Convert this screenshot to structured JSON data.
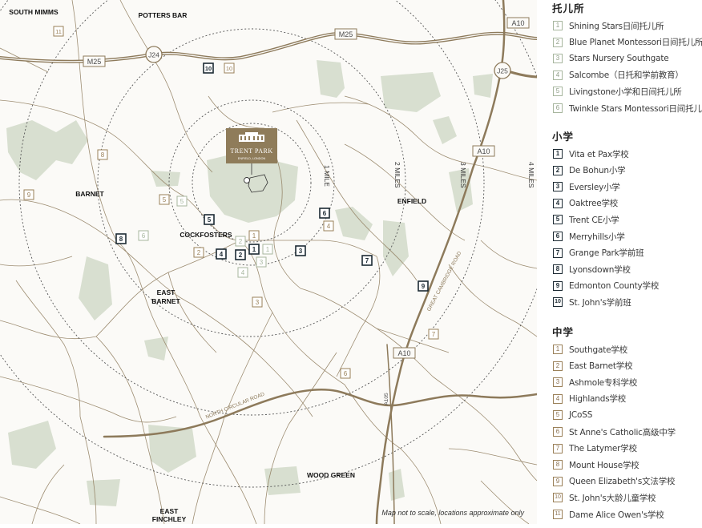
{
  "map": {
    "places": {
      "south_mimms": "SOUTH MIMMS",
      "potters_bar": "POTTERS BAR",
      "barnet": "BARNET",
      "cockfosters": "COCKFOSTERS",
      "east_barnet": "EAST\nBARNET",
      "enfield": "ENFIELD",
      "wood_green": "WOOD GREEN",
      "east_finchley": "EAST\nFINCHLEY"
    },
    "roads": {
      "m25_west": "M25",
      "m25_east": "M25",
      "j24": "J24",
      "j25": "J25",
      "a10_top": "A10",
      "a10_mid": "A10",
      "a10_low": "A10",
      "a1055": "A105",
      "great_cambridge_road": "GREAT CAMBRIDGE ROAD",
      "north_circular_road": "NORTH CIRCULAR ROAD"
    },
    "rings": {
      "mile1": "1 MILE",
      "mile2": "2 MILES",
      "mile3": "3 MILES",
      "mile4": "4 MILES"
    },
    "trent_park": {
      "name": "TRENT PARK",
      "subtitle": "ENFIELD, LONDON"
    },
    "note": "Map not to scale, locations approximate only",
    "colors": {
      "road": "#8d7a5b",
      "motorway": "#8d7a5b",
      "park": "#d8dfd0",
      "ring": "#555555",
      "nursery": "#a7b69e",
      "primary": "#1c2a33",
      "secondary": "#9a8058",
      "trent_badge": "#8f7c5a"
    },
    "markers": [
      {
        "cat": "secondary",
        "num": "11"
      },
      {
        "cat": "primary",
        "num": "10"
      },
      {
        "cat": "secondary",
        "num": "10"
      },
      {
        "cat": "secondary",
        "num": "8"
      },
      {
        "cat": "secondary",
        "num": "9"
      },
      {
        "cat": "secondary",
        "num": "5"
      },
      {
        "cat": "nursery",
        "num": "5"
      },
      {
        "cat": "primary",
        "num": "5"
      },
      {
        "cat": "primary",
        "num": "8"
      },
      {
        "cat": "nursery",
        "num": "6"
      },
      {
        "cat": "nursery",
        "num": "2"
      },
      {
        "cat": "secondary",
        "num": "1"
      },
      {
        "cat": "secondary",
        "num": "2"
      },
      {
        "cat": "primary",
        "num": "4"
      },
      {
        "cat": "primary",
        "num": "2"
      },
      {
        "cat": "primary",
        "num": "1"
      },
      {
        "cat": "nursery",
        "num": "1"
      },
      {
        "cat": "nursery",
        "num": "3"
      },
      {
        "cat": "nursery",
        "num": "4"
      },
      {
        "cat": "primary",
        "num": "3"
      },
      {
        "cat": "secondary",
        "num": "3"
      },
      {
        "cat": "primary",
        "num": "6"
      },
      {
        "cat": "secondary",
        "num": "4"
      },
      {
        "cat": "primary",
        "num": "7"
      },
      {
        "cat": "primary",
        "num": "9"
      },
      {
        "cat": "secondary",
        "num": "7"
      },
      {
        "cat": "secondary",
        "num": "6"
      }
    ]
  },
  "legend": {
    "sections": [
      {
        "title": "托儿所",
        "cat": "nursery",
        "items": [
          {
            "num": "1",
            "label": "Shining Stars日间托儿所"
          },
          {
            "num": "2",
            "label": "Blue Planet Montessori日间托儿所"
          },
          {
            "num": "3",
            "label": "Stars Nursery Southgate"
          },
          {
            "num": "4",
            "label": "Salcombe（日托和学前教育）"
          },
          {
            "num": "5",
            "label": "Livingstone小学和日间托儿所"
          },
          {
            "num": "6",
            "label": "Twinkle Stars Montessori日间托儿所"
          }
        ]
      },
      {
        "title": "小学",
        "cat": "primary",
        "items": [
          {
            "num": "1",
            "label": "Vita et Pax学校"
          },
          {
            "num": "2",
            "label": "De Bohun小学"
          },
          {
            "num": "3",
            "label": "Eversley小学"
          },
          {
            "num": "4",
            "label": "Oaktree学校"
          },
          {
            "num": "5",
            "label": "Trent CE小学"
          },
          {
            "num": "6",
            "label": "Merryhills小学"
          },
          {
            "num": "7",
            "label": "Grange Park学前班"
          },
          {
            "num": "8",
            "label": "Lyonsdown学校"
          },
          {
            "num": "9",
            "label": "Edmonton County学校"
          },
          {
            "num": "10",
            "label": "St. John's学前班"
          }
        ]
      },
      {
        "title": "中学",
        "cat": "secondary",
        "items": [
          {
            "num": "1",
            "label": "Southgate学校"
          },
          {
            "num": "2",
            "label": "East Barnet学校"
          },
          {
            "num": "3",
            "label": "Ashmole专科学校"
          },
          {
            "num": "4",
            "label": "Highlands学校"
          },
          {
            "num": "5",
            "label": "JCoSS"
          },
          {
            "num": "6",
            "label": "St Anne's Catholic高级中学"
          },
          {
            "num": "7",
            "label": "The Latymer学校"
          },
          {
            "num": "8",
            "label": "Mount House学校"
          },
          {
            "num": "9",
            "label": "Queen Elizabeth's文法学校"
          },
          {
            "num": "10",
            "label": "St. John's大龄儿童学校"
          },
          {
            "num": "11",
            "label": "Dame Alice Owen's学校"
          }
        ]
      }
    ]
  }
}
